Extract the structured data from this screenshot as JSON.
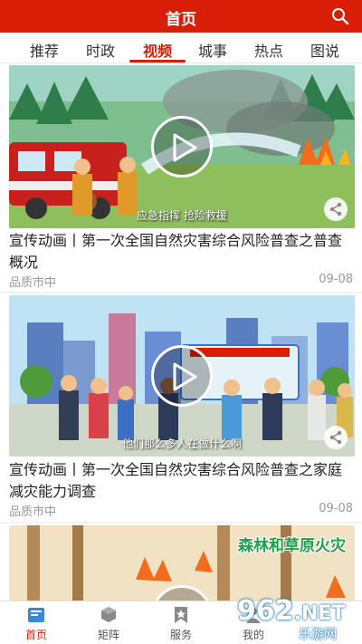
{
  "header": {
    "title": "首页"
  },
  "tabs": [
    {
      "label": "推荐"
    },
    {
      "label": "时政"
    },
    {
      "label": "视频"
    },
    {
      "label": "城事"
    },
    {
      "label": "热点"
    },
    {
      "label": "图说"
    }
  ],
  "active_tab": "视频",
  "feed": [
    {
      "thumb_caption": "应急指挥  抢险救援",
      "title": "宣传动画丨第一次全国自然灾害综合风险普查之普查概况",
      "source": "品质市中",
      "date": "09-08"
    },
    {
      "thumb_caption": "他们那么多人在做什么啊",
      "title": "宣传动画丨第一次全国自然灾害综合风险普查之家庭减灾能力调查",
      "source": "品质市中",
      "date": "09-08"
    },
    {
      "thumb_caption": "森林和草原火灾"
    }
  ],
  "bottom_nav": [
    {
      "label": "首页",
      "icon": "home-icon"
    },
    {
      "label": "矩阵",
      "icon": "cube-icon"
    },
    {
      "label": "服务",
      "icon": "star-bookmark-icon"
    },
    {
      "label": "我的",
      "icon": "user-icon"
    }
  ],
  "watermark": {
    "num": "962",
    "dot_net": ".NET",
    "cn": "乐游网"
  },
  "colors": {
    "brand": "#d81e06",
    "text": "#222222",
    "muted": "#999999"
  }
}
